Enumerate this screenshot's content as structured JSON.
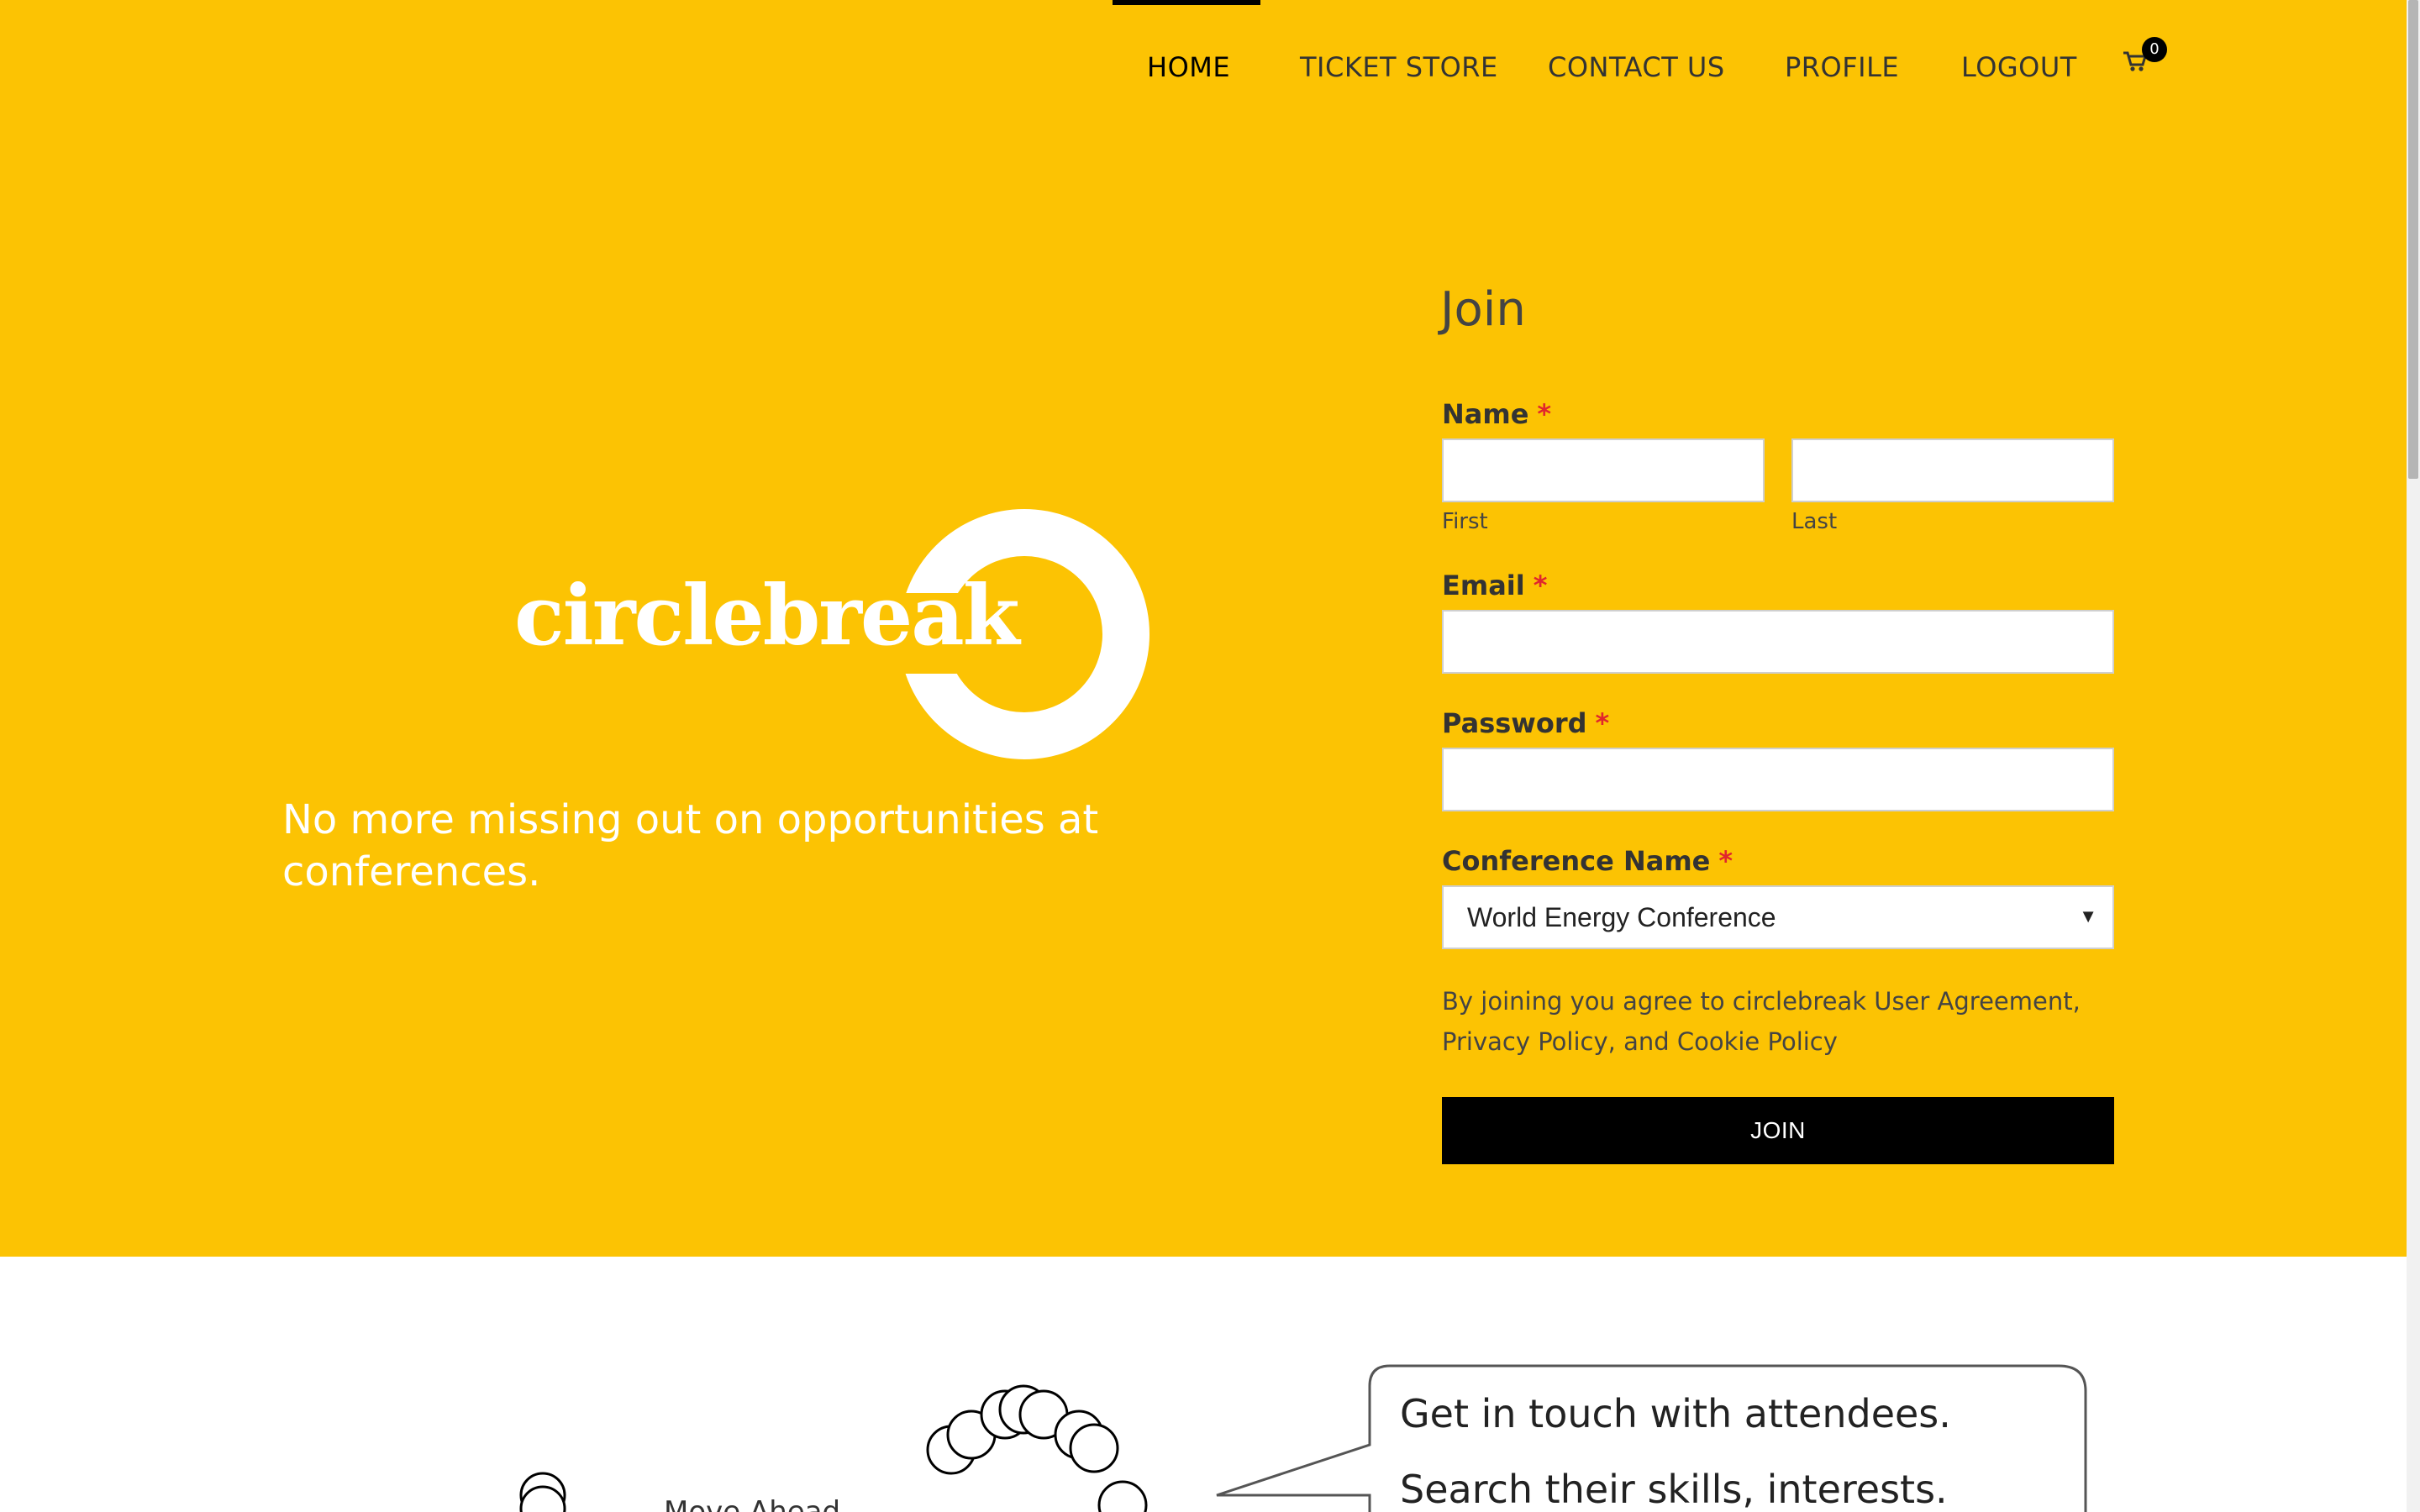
{
  "nav": {
    "items": [
      {
        "label": "HOME",
        "active": true
      },
      {
        "label": "TICKET STORE",
        "active": false
      },
      {
        "label": "CONTACT US",
        "active": false
      },
      {
        "label": "PROFILE",
        "active": false
      },
      {
        "label": "LOGOUT",
        "active": false
      }
    ],
    "cart_count": "0",
    "cart_icon": "shopping-cart-icon"
  },
  "hero": {
    "logo_text": "circlebreak",
    "tagline": "No more missing out on opportunities at conferences."
  },
  "form": {
    "title": "Join",
    "name_label": "Name",
    "first_sublabel": "First",
    "last_sublabel": "Last",
    "email_label": "Email",
    "password_label": "Password",
    "conference_label": "Conference Name",
    "conference_selected": "World Energy Conference",
    "required_mark": "*",
    "terms": "By joining you agree to circlebreak User Agreement, Privacy Policy, and Cookie Policy",
    "submit_label": "JOIN"
  },
  "lower": {
    "illustration_text": "Move Ahead",
    "bubble_lines": [
      "Get in touch with attendees.",
      "Search their skills, interests."
    ]
  },
  "colors": {
    "hero_bg": "#FCC303",
    "required": "#e0262d",
    "button_bg": "#000000"
  }
}
